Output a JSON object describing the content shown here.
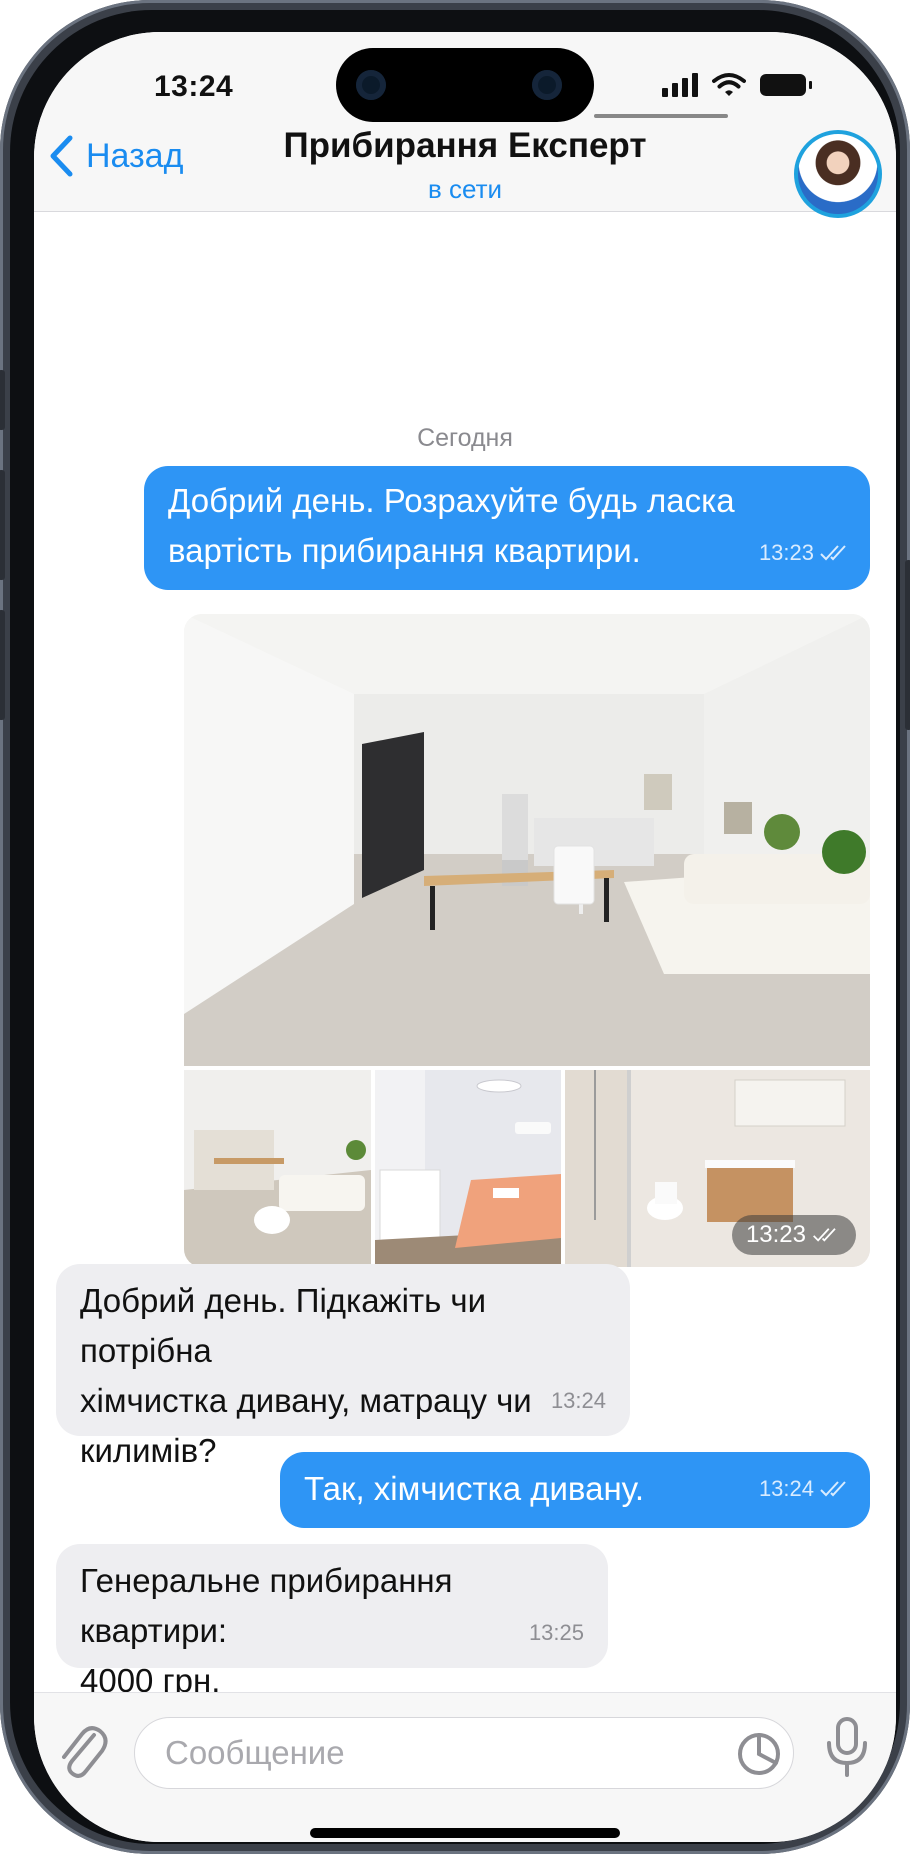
{
  "status_bar": {
    "time": "13:24"
  },
  "header": {
    "back_label": "Назад",
    "title": "Прибирання Експерт",
    "status": "в сети"
  },
  "chat": {
    "date_separator": "Сегодня",
    "messages": [
      {
        "direction": "out",
        "text_lines": [
          "Добрий день. Розрахуйте будь ласка",
          "вартість прибирання квартири."
        ],
        "time": "13:23",
        "read": true
      },
      {
        "direction": "out",
        "type": "photo_album",
        "photo_count": 4,
        "time": "13:23",
        "read": true
      },
      {
        "direction": "in",
        "text_lines": [
          "Добрий день. Підкажіть чи потрібна",
          "хімчистка дивану, матрацу чи",
          "килимів?"
        ],
        "time": "13:24"
      },
      {
        "direction": "out",
        "text_lines": [
          "Так, хімчистка дивану."
        ],
        "time": "13:24",
        "read": true
      },
      {
        "direction": "in",
        "text_lines": [
          "Генеральне прибирання квартири:",
          "4000 грн."
        ],
        "time": "13:25"
      }
    ]
  },
  "composer": {
    "placeholder": "Сообщение"
  },
  "colors": {
    "accent": "#1a8cf0",
    "outgoing_bubble": "#2e95f5",
    "incoming_bubble": "#eeeef1"
  },
  "icons": [
    "back-chevron-icon",
    "signal-icon",
    "wifi-icon",
    "battery-icon",
    "double-check-icon",
    "paperclip-icon",
    "sticker-icon",
    "microphone-icon"
  ]
}
